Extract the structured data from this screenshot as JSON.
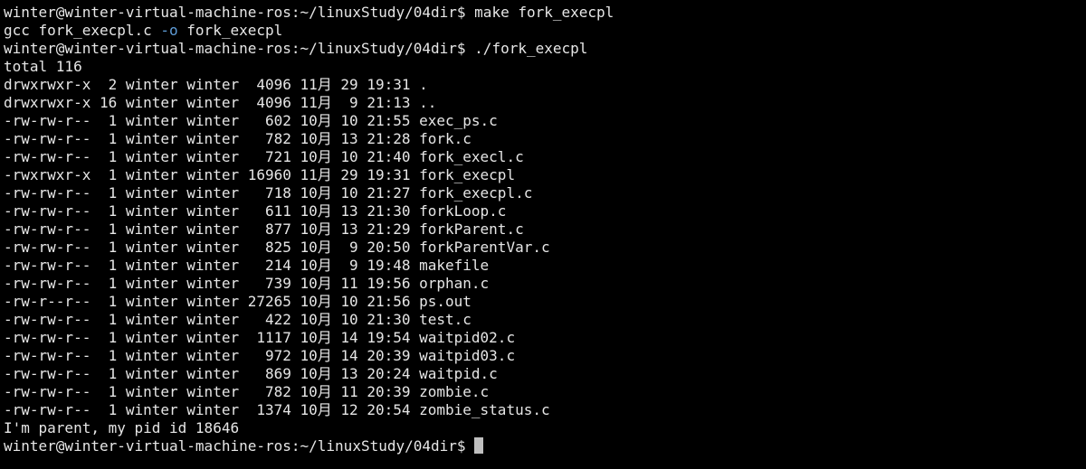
{
  "terminal": {
    "colors": {
      "background": "#000000",
      "text": "#e6e6e6",
      "flag": "#5f9dd8",
      "cursor": "#bfbfbf"
    },
    "cmd1": "winter@winter-virtual-machine-ros:~/linuxStudy/04dir$ make fork_execpl",
    "gcc_before": "gcc fork_execpl.c ",
    "gcc_flag": "-o",
    "gcc_after": " fork_execpl",
    "cmd2": "winter@winter-virtual-machine-ros:~/linuxStudy/04dir$ ./fork_execpl",
    "total": "total 116",
    "listing": [
      "drwxrwxr-x  2 winter winter  4096 11月 29 19:31 .",
      "drwxrwxr-x 16 winter winter  4096 11月  9 21:13 ..",
      "-rw-rw-r--  1 winter winter   602 10月 10 21:55 exec_ps.c",
      "-rw-rw-r--  1 winter winter   782 10月 13 21:28 fork.c",
      "-rw-rw-r--  1 winter winter   721 10月 10 21:40 fork_execl.c",
      "-rwxrwxr-x  1 winter winter 16960 11月 29 19:31 fork_execpl",
      "-rw-rw-r--  1 winter winter   718 10月 10 21:27 fork_execpl.c",
      "-rw-rw-r--  1 winter winter   611 10月 13 21:30 forkLoop.c",
      "-rw-rw-r--  1 winter winter   877 10月 13 21:29 forkParent.c",
      "-rw-rw-r--  1 winter winter   825 10月  9 20:50 forkParentVar.c",
      "-rw-rw-r--  1 winter winter   214 10月  9 19:48 makefile",
      "-rw-rw-r--  1 winter winter   739 10月 11 19:56 orphan.c",
      "-rw-r--r--  1 winter winter 27265 10月 10 21:56 ps.out",
      "-rw-rw-r--  1 winter winter   422 10月 10 21:30 test.c",
      "-rw-rw-r--  1 winter winter  1117 10月 14 19:54 waitpid02.c",
      "-rw-rw-r--  1 winter winter   972 10月 14 20:39 waitpid03.c",
      "-rw-rw-r--  1 winter winter   869 10月 13 20:24 waitpid.c",
      "-rw-rw-r--  1 winter winter   782 10月 11 20:39 zombie.c",
      "-rw-rw-r--  1 winter winter  1374 10月 12 20:54 zombie_status.c"
    ],
    "parent_msg": "I'm parent, my pid id 18646",
    "prompt": "winter@winter-virtual-machine-ros:~/linuxStudy/04dir$ "
  }
}
